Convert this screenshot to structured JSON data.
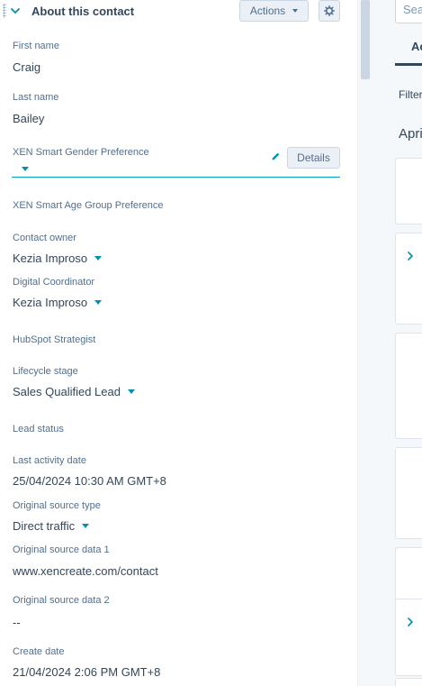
{
  "card": {
    "title": "About this contact",
    "actions_label": "Actions",
    "icons": [
      "chevron-down-icon",
      "gear-icon",
      "drag-handle-icon",
      "pencil-icon"
    ]
  },
  "fields": {
    "first_name": {
      "label": "First name",
      "value": "Craig"
    },
    "last_name": {
      "label": "Last name",
      "value": "Bailey"
    },
    "gender_pref": {
      "label": "XEN Smart Gender Preference",
      "value": "",
      "details_label": "Details"
    },
    "age_group_pref": {
      "label": "XEN Smart Age Group Preference"
    },
    "contact_owner": {
      "label": "Contact owner",
      "value": "Kezia Improso"
    },
    "digital_coordinator": {
      "label": "Digital Coordinator",
      "value": "Kezia Improso"
    },
    "hubspot_strategist": {
      "label": "HubSpot Strategist"
    },
    "lifecycle_stage": {
      "label": "Lifecycle stage",
      "value": "Sales Qualified Lead"
    },
    "lead_status": {
      "label": "Lead status"
    },
    "last_activity_date": {
      "label": "Last activity date",
      "value": "25/04/2024 10:30 AM GMT+8"
    },
    "original_source_type": {
      "label": "Original source type",
      "value": "Direct traffic"
    },
    "original_source_data_1": {
      "label": "Original source data 1",
      "value": "www.xencreate.com/contact"
    },
    "original_source_data_2": {
      "label": "Original source data 2",
      "value": "--"
    },
    "create_date": {
      "label": "Create date",
      "value": "21/04/2024 2:06 PM GMT+8"
    }
  },
  "right_panel": {
    "search_placeholder": "Sea",
    "active_tab": "Ac",
    "filter_label": "Filter",
    "month_label": "April"
  },
  "colors": {
    "accent": "#0091ae",
    "underline": "#00a4bd",
    "text": "#33475b",
    "label": "#516f90",
    "button_bg": "#eaf0f6"
  }
}
